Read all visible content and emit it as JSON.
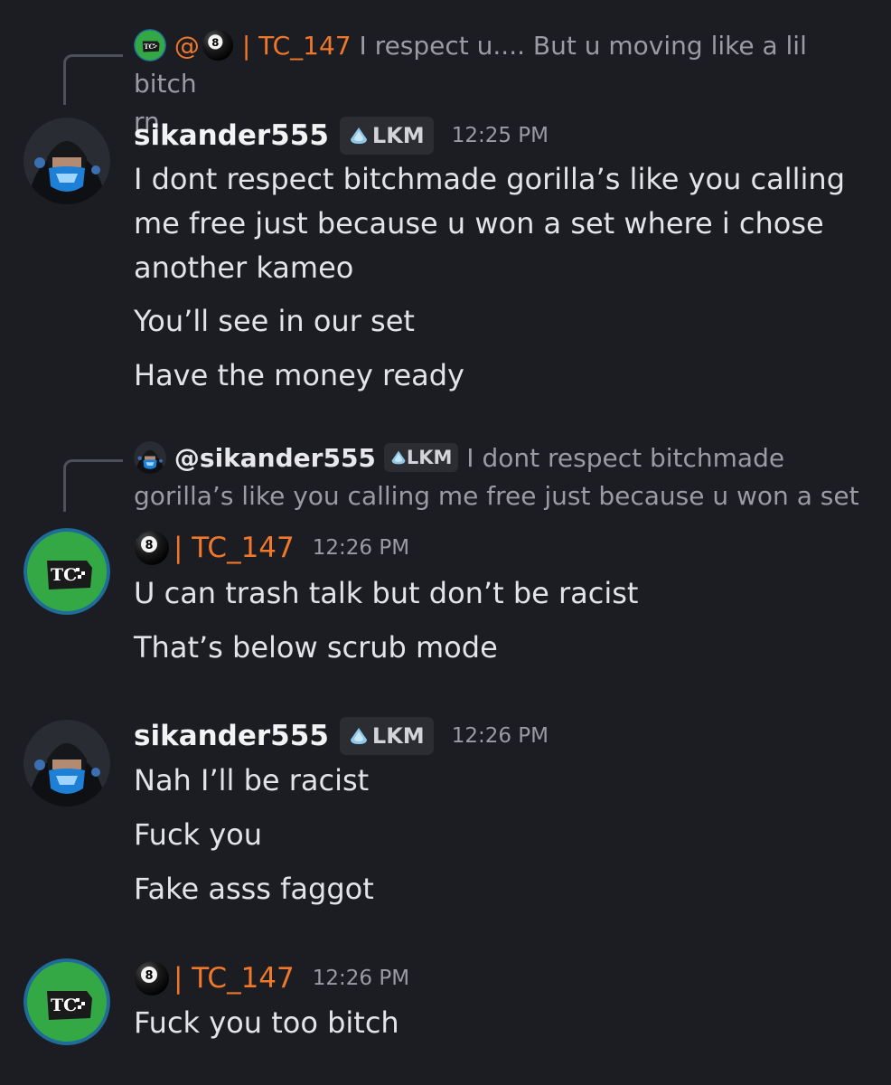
{
  "messages": [
    {
      "reply": {
        "prefix": "@",
        "name": "| TC_147",
        "text_line1": "I respect u.... But u moving like a lil bitch",
        "text_line2": "rn"
      },
      "author": "sikander555",
      "badge": "LKM",
      "time": "12:25 PM",
      "lines": [
        "I dont respect bitchmade gorilla’s like you calling",
        "me free just because u won a set where i chose",
        "another kameo",
        "You’ll see in our set",
        "Have the money ready"
      ]
    },
    {
      "reply": {
        "name": "@sikander555",
        "badge": "LKM",
        "text_line1": "I dont respect bitchmade",
        "text_line2": "gorilla’s like you calling me free just because u won a set ..."
      },
      "author": "| TC_147",
      "time": "12:26 PM",
      "lines": [
        "U can trash talk but don’t be racist",
        "That’s below scrub mode"
      ]
    },
    {
      "author": "sikander555",
      "badge": "LKM",
      "time": "12:26 PM",
      "lines": [
        "Nah I’ll be racist",
        "Fuck you",
        "Fake asss faggot"
      ]
    },
    {
      "author": "| TC_147",
      "time": "12:26 PM",
      "lines": [
        "Fuck you too bitch"
      ]
    }
  ],
  "colors": {
    "background": "#1c1d22",
    "accent_orange": "#f0782b",
    "badge_bg": "#2b2d33",
    "muted_text": "#9a9ba3"
  },
  "icons": [
    "eight-ball-icon",
    "diamond-icon",
    "tc-avatar-icon",
    "ninja-avatar-icon"
  ]
}
